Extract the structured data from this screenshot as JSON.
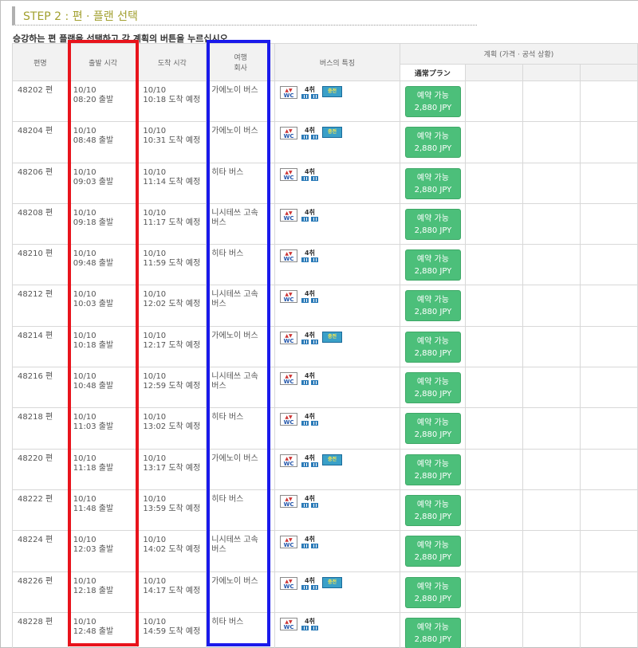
{
  "step_title": "STEP 2 : 편 · 플랜 선택",
  "instruction": "승강하는 편 플랜을 선택하고 각 계획의 버튼을 누르십시오",
  "headers": {
    "bus_no": "편명",
    "depart_time": "출발 시각",
    "arrive_time": "도착 시각",
    "company_line1": "여행",
    "company_line2": "회사",
    "features": "버스의 특징",
    "plan_group": "계획 (가격 · 공석 상황)",
    "plan_name": "通常プラン"
  },
  "icons": {
    "wc": "WC",
    "seat_label": "4취",
    "charge": "충전"
  },
  "colors": {
    "reserve_button": "#4cbf7a",
    "highlight_red": "#e8141c",
    "highlight_blue": "#1a1aeb",
    "step_title": "#a2a030"
  },
  "rows": [
    {
      "no": "48202 편",
      "dep_date": "10/10",
      "dep_time": "08:20 출발",
      "arr_date": "10/10",
      "arr_time": "10:18 도착 예정",
      "company": "가에노이 버스",
      "company2": "",
      "charge": true,
      "btn1": "예약 가능",
      "btn2": "2,880 JPY"
    },
    {
      "no": "48204 편",
      "dep_date": "10/10",
      "dep_time": "08:48 출발",
      "arr_date": "10/10",
      "arr_time": "10:31 도착 예정",
      "company": "가에노이 버스",
      "company2": "",
      "charge": true,
      "btn1": "예약 가능",
      "btn2": "2,880 JPY"
    },
    {
      "no": "48206 편",
      "dep_date": "10/10",
      "dep_time": "09:03 출발",
      "arr_date": "10/10",
      "arr_time": "11:14 도착 예정",
      "company": "히타 버스",
      "company2": "",
      "charge": false,
      "btn1": "예약 가능",
      "btn2": "2,880 JPY"
    },
    {
      "no": "48208 편",
      "dep_date": "10/10",
      "dep_time": "09:18 출발",
      "arr_date": "10/10",
      "arr_time": "11:17 도착 예정",
      "company": "니시테쓰 고속",
      "company2": "버스",
      "charge": false,
      "btn1": "예약 가능",
      "btn2": "2,880 JPY"
    },
    {
      "no": "48210 편",
      "dep_date": "10/10",
      "dep_time": "09:48 출발",
      "arr_date": "10/10",
      "arr_time": "11:59 도착 예정",
      "company": "히타 버스",
      "company2": "",
      "charge": false,
      "btn1": "예약 가능",
      "btn2": "2,880 JPY"
    },
    {
      "no": "48212 편",
      "dep_date": "10/10",
      "dep_time": "10:03 출발",
      "arr_date": "10/10",
      "arr_time": "12:02 도착 예정",
      "company": "니시테쓰 고속",
      "company2": "버스",
      "charge": false,
      "btn1": "예약 가능",
      "btn2": "2,880 JPY"
    },
    {
      "no": "48214 편",
      "dep_date": "10/10",
      "dep_time": "10:18 출발",
      "arr_date": "10/10",
      "arr_time": "12:17 도착 예정",
      "company": "가에노이 버스",
      "company2": "",
      "charge": true,
      "btn1": "예약 가능",
      "btn2": "2,880 JPY"
    },
    {
      "no": "48216 편",
      "dep_date": "10/10",
      "dep_time": "10:48 출발",
      "arr_date": "10/10",
      "arr_time": "12:59 도착 예정",
      "company": "니시테쓰 고속",
      "company2": "버스",
      "charge": false,
      "btn1": "예약 가능",
      "btn2": "2,880 JPY"
    },
    {
      "no": "48218 편",
      "dep_date": "10/10",
      "dep_time": "11:03 출발",
      "arr_date": "10/10",
      "arr_time": "13:02 도착 예정",
      "company": "히타 버스",
      "company2": "",
      "charge": false,
      "btn1": "예약 가능",
      "btn2": "2,880 JPY"
    },
    {
      "no": "48220 편",
      "dep_date": "10/10",
      "dep_time": "11:18 출발",
      "arr_date": "10/10",
      "arr_time": "13:17 도착 예정",
      "company": "가에노이 버스",
      "company2": "",
      "charge": true,
      "btn1": "예약 가능",
      "btn2": "2,880 JPY"
    },
    {
      "no": "48222 편",
      "dep_date": "10/10",
      "dep_time": "11:48 출발",
      "arr_date": "10/10",
      "arr_time": "13:59 도착 예정",
      "company": "히타 버스",
      "company2": "",
      "charge": false,
      "btn1": "예약 가능",
      "btn2": "2,880 JPY"
    },
    {
      "no": "48224 편",
      "dep_date": "10/10",
      "dep_time": "12:03 출발",
      "arr_date": "10/10",
      "arr_time": "14:02 도착 예정",
      "company": "니시테쓰 고속",
      "company2": "버스",
      "charge": false,
      "btn1": "예약 가능",
      "btn2": "2,880 JPY"
    },
    {
      "no": "48226 편",
      "dep_date": "10/10",
      "dep_time": "12:18 출발",
      "arr_date": "10/10",
      "arr_time": "14:17 도착 예정",
      "company": "가에노이 버스",
      "company2": "",
      "charge": true,
      "btn1": "예약 가능",
      "btn2": "2,880 JPY"
    },
    {
      "no": "48228 편",
      "dep_date": "10/10",
      "dep_time": "12:48 출발",
      "arr_date": "10/10",
      "arr_time": "14:59 도착 예정",
      "company": "히타 버스",
      "company2": "",
      "charge": false,
      "btn1": "예약 가능",
      "btn2": "2,880 JPY"
    }
  ]
}
